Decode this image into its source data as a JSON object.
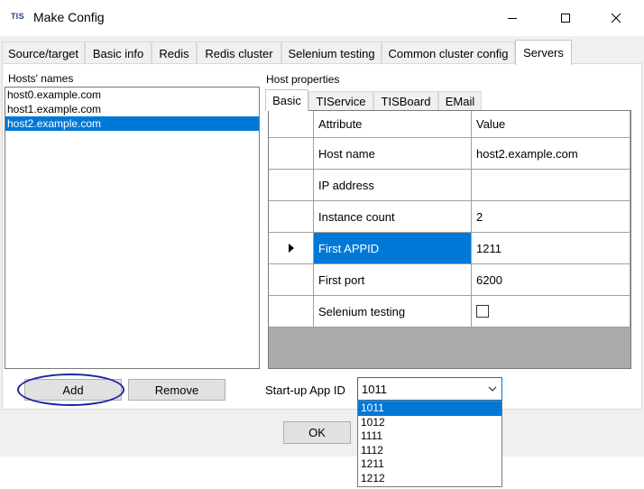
{
  "window": {
    "title": "Make Config",
    "app_icon_text": "TIS",
    "minimize": "–",
    "maximize": "□",
    "close": "✕"
  },
  "tabs": [
    {
      "label": "Source/target"
    },
    {
      "label": "Basic info"
    },
    {
      "label": "Redis"
    },
    {
      "label": "Redis cluster"
    },
    {
      "label": "Selenium testing"
    },
    {
      "label": "Common cluster config"
    },
    {
      "label": "Servers",
      "active": true
    }
  ],
  "hosts": {
    "label": "Hosts' names",
    "items": [
      "host0.example.com",
      "host1.example.com",
      "host2.example.com"
    ],
    "selected_index": 2
  },
  "host_properties": {
    "label": "Host properties",
    "subtabs": [
      {
        "label": "Basic",
        "active": true
      },
      {
        "label": "TIService"
      },
      {
        "label": "TISBoard"
      },
      {
        "label": "EMail"
      }
    ],
    "grid": {
      "headers": {
        "attribute": "Attribute",
        "value": "Value"
      },
      "rows": [
        {
          "attribute": "Host name",
          "value": "host2.example.com"
        },
        {
          "attribute": "IP address",
          "value": ""
        },
        {
          "attribute": "Instance count",
          "value": "2"
        },
        {
          "attribute": "First APPID",
          "value": "1211",
          "current": true
        },
        {
          "attribute": "First port",
          "value": "6200"
        },
        {
          "attribute": "Selenium testing",
          "value": "",
          "checkbox": true,
          "checked": false
        }
      ]
    }
  },
  "buttons": {
    "add": "Add",
    "remove": "Remove",
    "ok": "OK"
  },
  "startup": {
    "label": "Start-up App ID",
    "selected": "1011",
    "options": [
      "1011",
      "1012",
      "1111",
      "1112",
      "1211",
      "1212"
    ],
    "highlighted_index": 0
  },
  "colors": {
    "selection": "#0078d7",
    "annotation": "#1a23a6"
  }
}
